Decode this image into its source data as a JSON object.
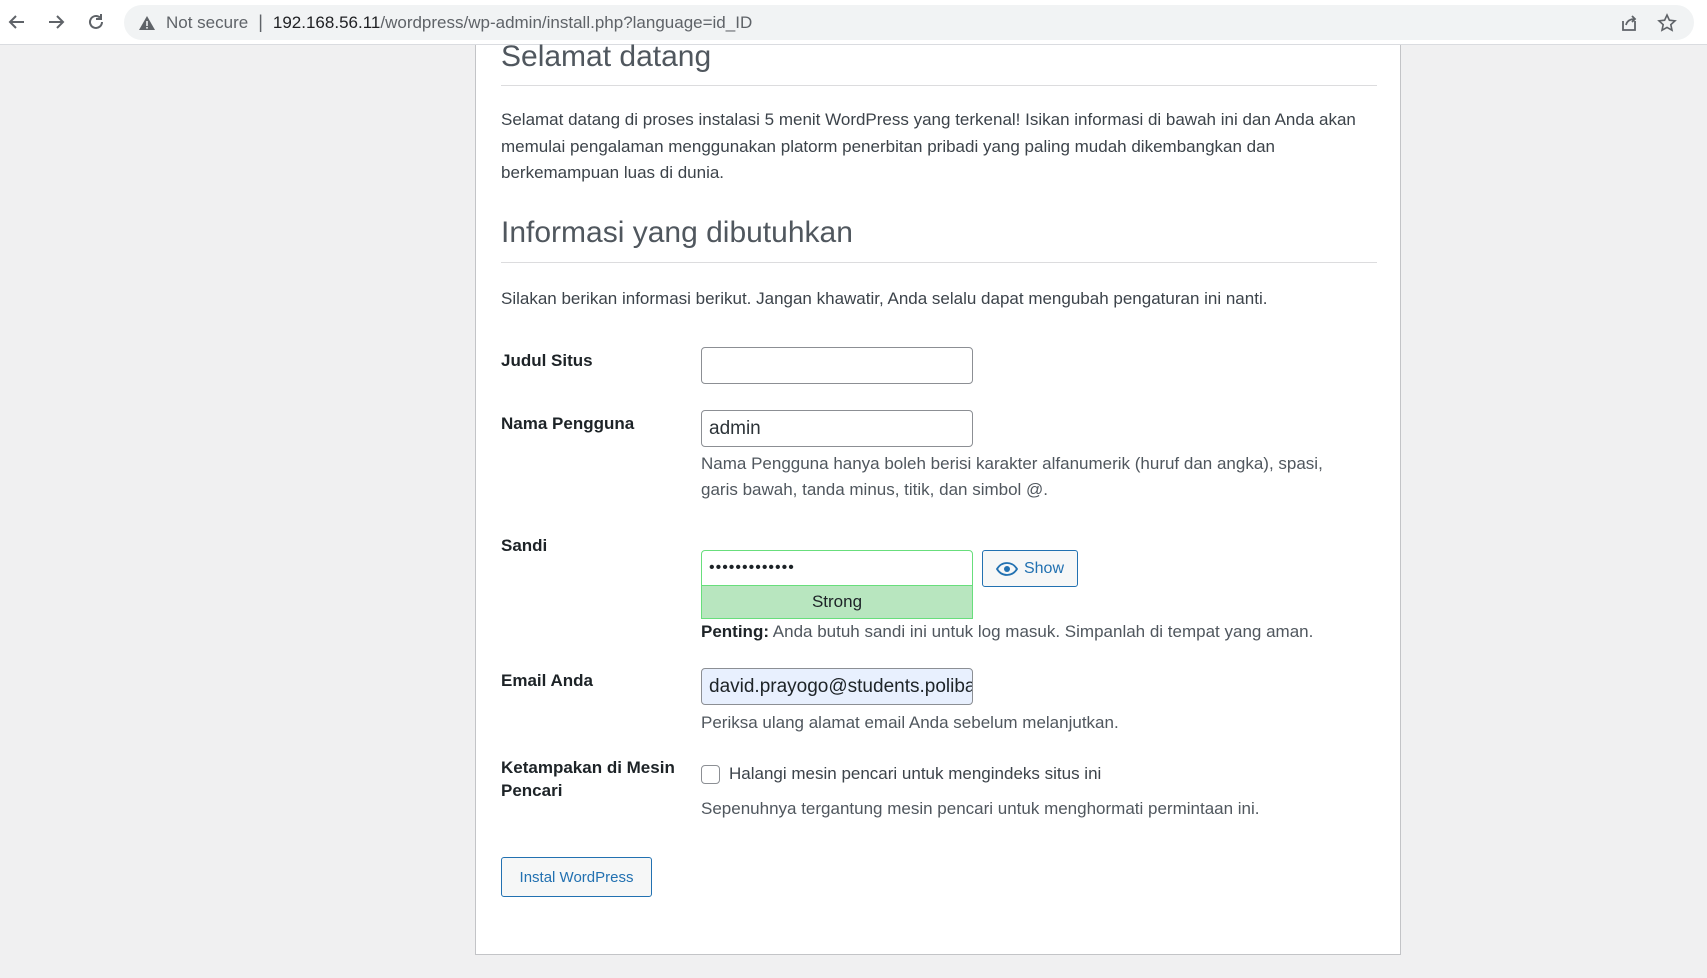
{
  "browser": {
    "security_label": "Not secure",
    "url_host": "192.168.56.11",
    "url_path": "/wordpress/wp-admin/install.php?language=id_ID"
  },
  "welcome": {
    "heading": "Selamat datang",
    "body": "Selamat datang di proses instalasi 5 menit WordPress yang terkenal! Isikan informasi di bawah ini dan Anda akan memulai pengalaman menggunakan platorm penerbitan pribadi yang paling mudah dikembangkan dan berkemampuan luas di dunia."
  },
  "info": {
    "heading": "Informasi yang dibutuhkan",
    "intro": "Silakan berikan informasi berikut. Jangan khawatir, Anda selalu dapat mengubah pengaturan ini nanti."
  },
  "form": {
    "site_title": {
      "label": "Judul Situs",
      "value": ""
    },
    "username": {
      "label": "Nama Pengguna",
      "value": "admin",
      "help_line1": "Nama Pengguna hanya boleh berisi karakter alfanumerik (huruf dan angka), spasi,",
      "help_line2": "garis bawah, tanda minus, titik, dan simbol @."
    },
    "password": {
      "label": "Sandi",
      "value": "•••••••••••••",
      "strength": "Strong",
      "show_label": "Show",
      "important_prefix": "Penting:",
      "important_text": " Anda butuh sandi ini untuk log masuk. Simpanlah di tempat yang aman."
    },
    "email": {
      "label": "Email Anda",
      "value": "david.prayogo@students.poliba",
      "help": "Periksa ulang alamat email Anda sebelum melanjutkan."
    },
    "visibility": {
      "label_line1": "Ketampakan di Mesin",
      "label_line2": "Pencari",
      "checkbox_label": "Halangi mesin pencari untuk mengindeks situs ini",
      "checked": false,
      "help": "Sepenuhnya tergantung mesin pencari untuk menghormati permintaan ini."
    },
    "submit_label": "Instal WordPress"
  },
  "colors": {
    "accent": "#2271b1",
    "strength_bg": "#b8e6bf",
    "strength_border": "#68de7c",
    "page_bg": "#f0f0f1"
  }
}
